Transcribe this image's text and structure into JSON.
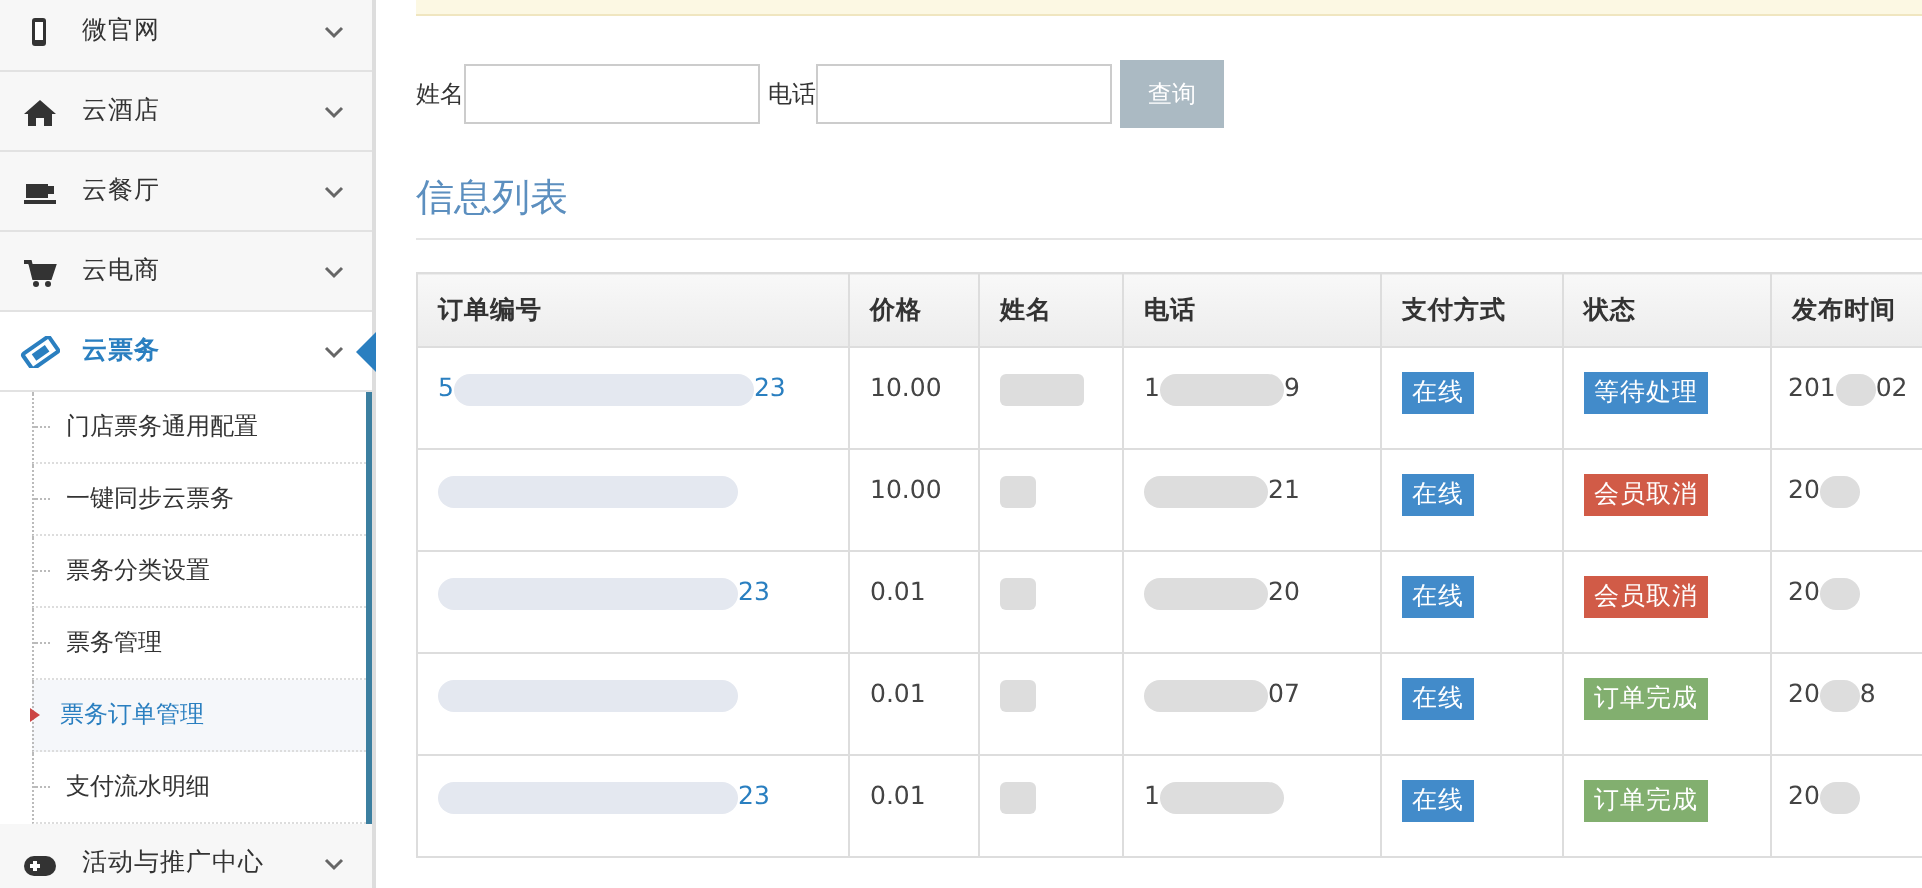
{
  "sidebar": {
    "items": [
      {
        "label": "微官网",
        "selected": false
      },
      {
        "label": "云酒店",
        "selected": false
      },
      {
        "label": "云餐厅",
        "selected": false
      },
      {
        "label": "云电商",
        "selected": false
      },
      {
        "label": "云票务",
        "selected": true,
        "children": [
          {
            "label": "门店票务通用配置",
            "selected": false
          },
          {
            "label": "一键同步云票务",
            "selected": false
          },
          {
            "label": "票务分类设置",
            "selected": false
          },
          {
            "label": "票务管理",
            "selected": false
          },
          {
            "label": "票务订单管理",
            "selected": true
          },
          {
            "label": "支付流水明细",
            "selected": false
          }
        ]
      },
      {
        "label": "活动与推广中心",
        "selected": false
      }
    ]
  },
  "search": {
    "fields": [
      {
        "label": "姓名"
      },
      {
        "label": "电话"
      }
    ],
    "button": "查询"
  },
  "list_title": "信息列表",
  "table": {
    "columns": [
      "订单编号",
      "价格",
      "姓名",
      "电话",
      "支付方式",
      "状态",
      "发布时间"
    ],
    "rows": [
      {
        "order_no": {
          "prefix": "5",
          "suffix": "23"
        },
        "price": "10.00",
        "phone": {
          "prefix": "1",
          "suffix": "9"
        },
        "payment": "在线",
        "status": {
          "text": "等待处理",
          "color": "#428bca"
        },
        "time": {
          "prefix": "201",
          "suffix": "02"
        }
      },
      {
        "order_no": {},
        "price": "10.00",
        "phone": {
          "suffix": "21"
        },
        "payment": "在线",
        "status": {
          "text": "会员取消",
          "color": "#d15b47"
        },
        "time": {
          "prefix": "20"
        }
      },
      {
        "order_no": {
          "suffix": "23"
        },
        "price": "0.01",
        "phone": {
          "suffix": "20"
        },
        "payment": "在线",
        "status": {
          "text": "会员取消",
          "color": "#d15b47"
        },
        "time": {
          "prefix": "20"
        }
      },
      {
        "order_no": {},
        "price": "0.01",
        "phone": {
          "suffix": "07"
        },
        "payment": "在线",
        "status": {
          "text": "订单完成",
          "color": "#82af6f"
        },
        "time": {
          "prefix": "20",
          "suffix": "8"
        }
      },
      {
        "order_no": {
          "suffix": "23"
        },
        "price": "0.01",
        "phone": {
          "prefix": "1"
        },
        "payment": "在线",
        "status": {
          "text": "订单完成",
          "color": "#82af6f"
        },
        "time": {
          "prefix": "20"
        }
      }
    ]
  }
}
